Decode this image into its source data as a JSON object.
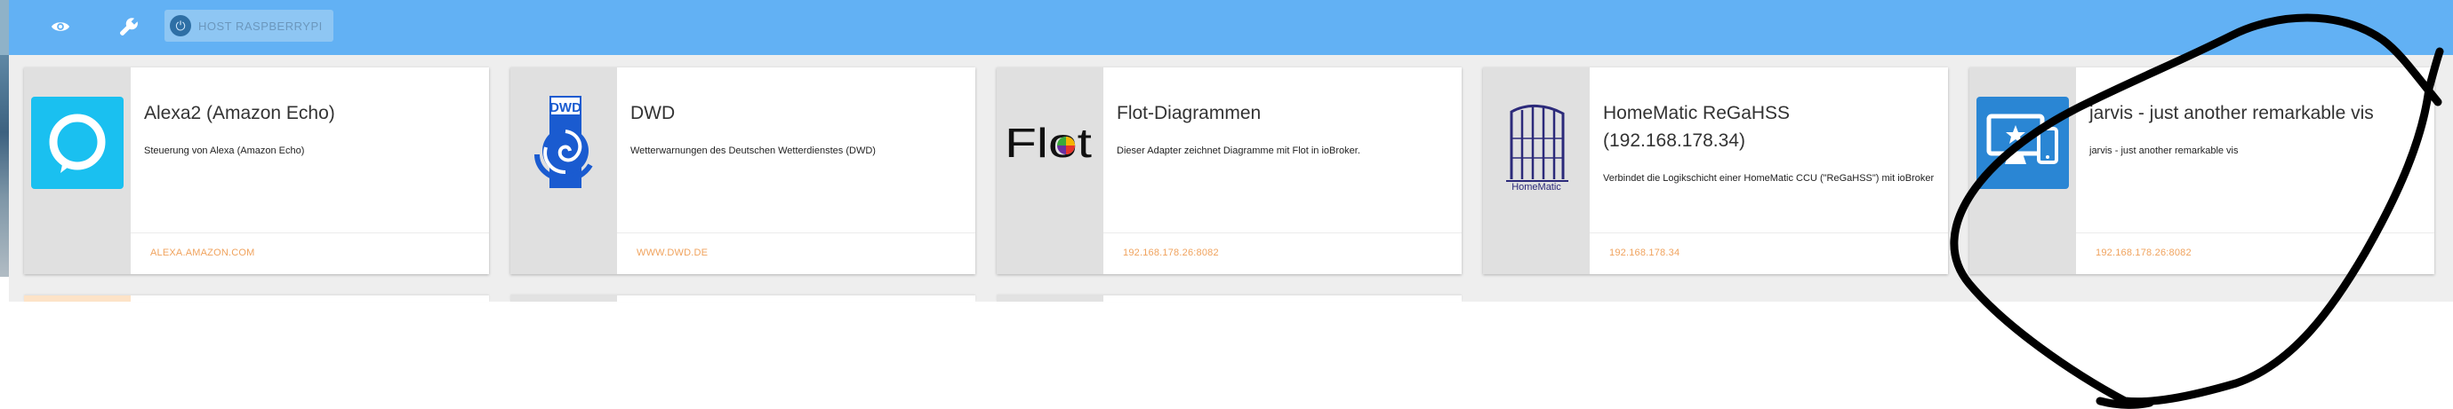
{
  "topbar": {
    "host_label": "HOST RASPBERRYPI",
    "icons": {
      "eye": "eye-icon",
      "wrench": "wrench-icon",
      "power": "power-icon"
    },
    "colors": {
      "bar": "#62b1f4",
      "chip": "#8ec6f3"
    }
  },
  "adapters": [
    {
      "title": "Alexa2 (Amazon Echo)",
      "description": "Steuerung von Alexa (Amazon Echo)",
      "link": "ALEXA.AMAZON.COM",
      "icon": "alexa-logo"
    },
    {
      "title": "DWD",
      "description": "Wetterwarnungen des Deutschen Wetterdienstes (DWD)",
      "link": "WWW.DWD.DE",
      "icon": "dwd-logo",
      "logo_text": "DWD"
    },
    {
      "title": "Flot-Diagrammen",
      "description": "Dieser Adapter zeichnet Diagramme mit Flot in ioBroker.",
      "link": "192.168.178.26:8082",
      "icon": "flot-logo",
      "logo_text": "Flot"
    },
    {
      "title": "HomeMatic ReGaHSS (192.168.178.34)",
      "description": "Verbindet die Logikschicht einer HomeMatic CCU (\"ReGaHSS\") mit ioBroker",
      "link": "192.168.178.34",
      "icon": "homematic-logo",
      "logo_text": "HomeMatic"
    },
    {
      "title": "jarvis - just another remarkable vis",
      "description": "jarvis - just another remarkable vis",
      "link": "192.168.178.26:8082",
      "icon": "jarvis-logo"
    }
  ],
  "colors": {
    "link": "#f0a35e",
    "annotation": "#000000",
    "alexa": "#1ac0f0",
    "dwd": "#1a5bd0",
    "jarvis": "#2a86d4",
    "homematic": "#2c2a7a"
  }
}
